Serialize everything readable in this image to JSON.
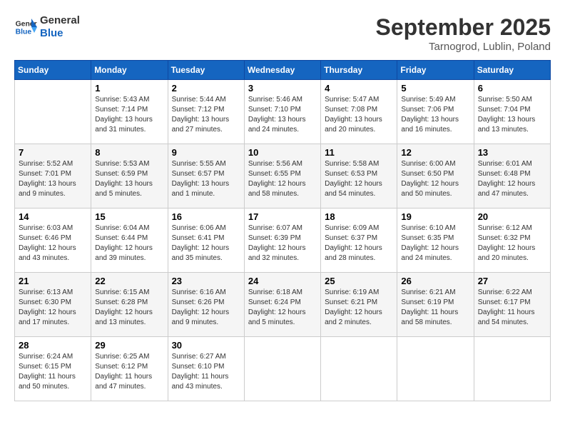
{
  "header": {
    "logo_line1": "General",
    "logo_line2": "Blue",
    "month": "September 2025",
    "location": "Tarnogrod, Lublin, Poland"
  },
  "days_of_week": [
    "Sunday",
    "Monday",
    "Tuesday",
    "Wednesday",
    "Thursday",
    "Friday",
    "Saturday"
  ],
  "weeks": [
    [
      {
        "day": "",
        "info": ""
      },
      {
        "day": "1",
        "info": "Sunrise: 5:43 AM\nSunset: 7:14 PM\nDaylight: 13 hours\nand 31 minutes."
      },
      {
        "day": "2",
        "info": "Sunrise: 5:44 AM\nSunset: 7:12 PM\nDaylight: 13 hours\nand 27 minutes."
      },
      {
        "day": "3",
        "info": "Sunrise: 5:46 AM\nSunset: 7:10 PM\nDaylight: 13 hours\nand 24 minutes."
      },
      {
        "day": "4",
        "info": "Sunrise: 5:47 AM\nSunset: 7:08 PM\nDaylight: 13 hours\nand 20 minutes."
      },
      {
        "day": "5",
        "info": "Sunrise: 5:49 AM\nSunset: 7:06 PM\nDaylight: 13 hours\nand 16 minutes."
      },
      {
        "day": "6",
        "info": "Sunrise: 5:50 AM\nSunset: 7:04 PM\nDaylight: 13 hours\nand 13 minutes."
      }
    ],
    [
      {
        "day": "7",
        "info": "Sunrise: 5:52 AM\nSunset: 7:01 PM\nDaylight: 13 hours\nand 9 minutes."
      },
      {
        "day": "8",
        "info": "Sunrise: 5:53 AM\nSunset: 6:59 PM\nDaylight: 13 hours\nand 5 minutes."
      },
      {
        "day": "9",
        "info": "Sunrise: 5:55 AM\nSunset: 6:57 PM\nDaylight: 13 hours\nand 1 minute."
      },
      {
        "day": "10",
        "info": "Sunrise: 5:56 AM\nSunset: 6:55 PM\nDaylight: 12 hours\nand 58 minutes."
      },
      {
        "day": "11",
        "info": "Sunrise: 5:58 AM\nSunset: 6:53 PM\nDaylight: 12 hours\nand 54 minutes."
      },
      {
        "day": "12",
        "info": "Sunrise: 6:00 AM\nSunset: 6:50 PM\nDaylight: 12 hours\nand 50 minutes."
      },
      {
        "day": "13",
        "info": "Sunrise: 6:01 AM\nSunset: 6:48 PM\nDaylight: 12 hours\nand 47 minutes."
      }
    ],
    [
      {
        "day": "14",
        "info": "Sunrise: 6:03 AM\nSunset: 6:46 PM\nDaylight: 12 hours\nand 43 minutes."
      },
      {
        "day": "15",
        "info": "Sunrise: 6:04 AM\nSunset: 6:44 PM\nDaylight: 12 hours\nand 39 minutes."
      },
      {
        "day": "16",
        "info": "Sunrise: 6:06 AM\nSunset: 6:41 PM\nDaylight: 12 hours\nand 35 minutes."
      },
      {
        "day": "17",
        "info": "Sunrise: 6:07 AM\nSunset: 6:39 PM\nDaylight: 12 hours\nand 32 minutes."
      },
      {
        "day": "18",
        "info": "Sunrise: 6:09 AM\nSunset: 6:37 PM\nDaylight: 12 hours\nand 28 minutes."
      },
      {
        "day": "19",
        "info": "Sunrise: 6:10 AM\nSunset: 6:35 PM\nDaylight: 12 hours\nand 24 minutes."
      },
      {
        "day": "20",
        "info": "Sunrise: 6:12 AM\nSunset: 6:32 PM\nDaylight: 12 hours\nand 20 minutes."
      }
    ],
    [
      {
        "day": "21",
        "info": "Sunrise: 6:13 AM\nSunset: 6:30 PM\nDaylight: 12 hours\nand 17 minutes."
      },
      {
        "day": "22",
        "info": "Sunrise: 6:15 AM\nSunset: 6:28 PM\nDaylight: 12 hours\nand 13 minutes."
      },
      {
        "day": "23",
        "info": "Sunrise: 6:16 AM\nSunset: 6:26 PM\nDaylight: 12 hours\nand 9 minutes."
      },
      {
        "day": "24",
        "info": "Sunrise: 6:18 AM\nSunset: 6:24 PM\nDaylight: 12 hours\nand 5 minutes."
      },
      {
        "day": "25",
        "info": "Sunrise: 6:19 AM\nSunset: 6:21 PM\nDaylight: 12 hours\nand 2 minutes."
      },
      {
        "day": "26",
        "info": "Sunrise: 6:21 AM\nSunset: 6:19 PM\nDaylight: 11 hours\nand 58 minutes."
      },
      {
        "day": "27",
        "info": "Sunrise: 6:22 AM\nSunset: 6:17 PM\nDaylight: 11 hours\nand 54 minutes."
      }
    ],
    [
      {
        "day": "28",
        "info": "Sunrise: 6:24 AM\nSunset: 6:15 PM\nDaylight: 11 hours\nand 50 minutes."
      },
      {
        "day": "29",
        "info": "Sunrise: 6:25 AM\nSunset: 6:12 PM\nDaylight: 11 hours\nand 47 minutes."
      },
      {
        "day": "30",
        "info": "Sunrise: 6:27 AM\nSunset: 6:10 PM\nDaylight: 11 hours\nand 43 minutes."
      },
      {
        "day": "",
        "info": ""
      },
      {
        "day": "",
        "info": ""
      },
      {
        "day": "",
        "info": ""
      },
      {
        "day": "",
        "info": ""
      }
    ]
  ]
}
